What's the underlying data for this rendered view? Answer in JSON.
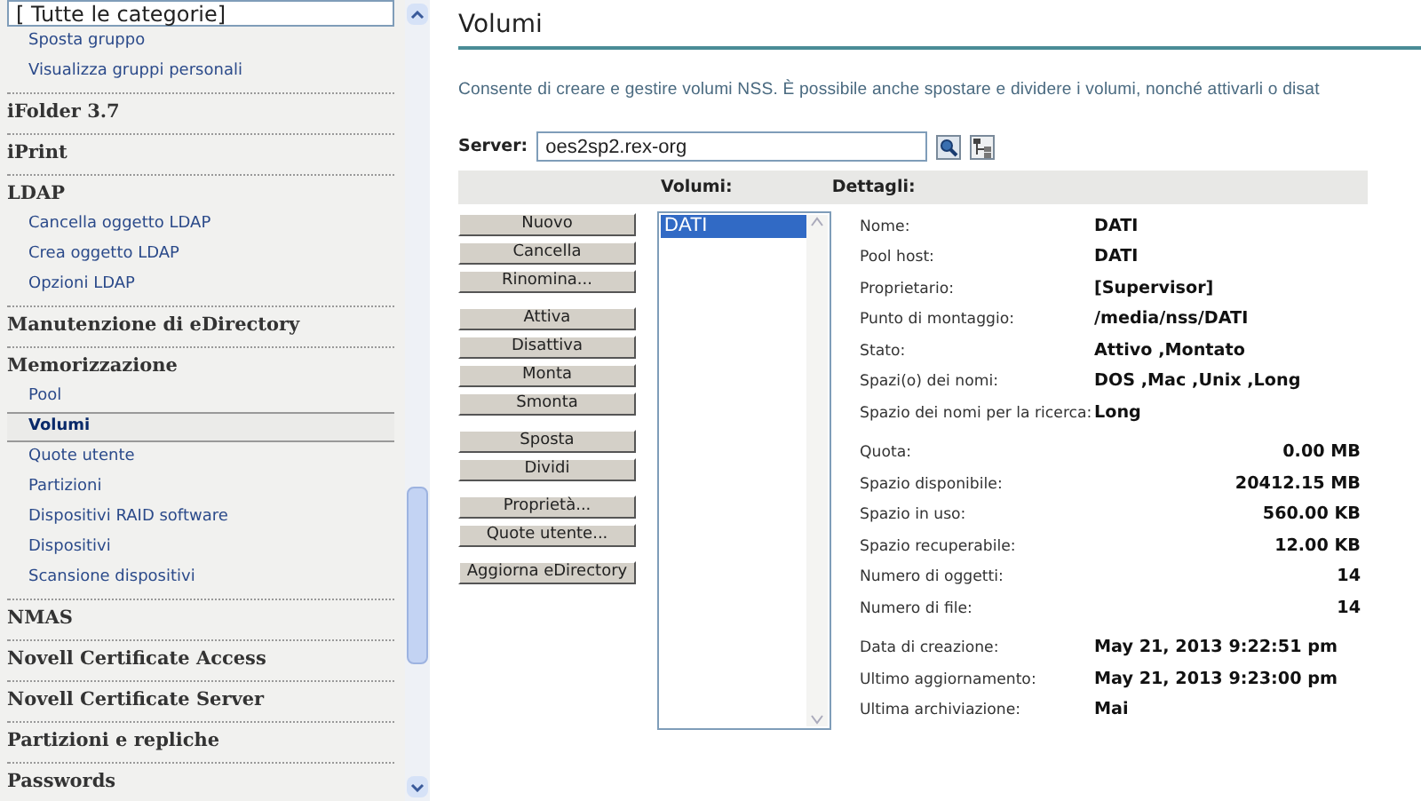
{
  "sidebar": {
    "category_select": {
      "value": "[ Tutte le categorie]"
    },
    "sections": [
      {
        "items": [
          {
            "label": "Sposta gruppo",
            "selected": false
          },
          {
            "label": "Visualizza gruppi personali",
            "selected": false
          }
        ]
      },
      {
        "title": "iFolder 3.7"
      },
      {
        "title": "iPrint"
      },
      {
        "title": "LDAP",
        "items": [
          {
            "label": "Cancella oggetto LDAP",
            "selected": false
          },
          {
            "label": "Crea oggetto LDAP",
            "selected": false
          },
          {
            "label": "Opzioni LDAP",
            "selected": false
          }
        ]
      },
      {
        "title": "Manutenzione di eDirectory"
      },
      {
        "title": "Memorizzazione",
        "items": [
          {
            "label": "Pool",
            "selected": false
          },
          {
            "label": "Volumi",
            "selected": true
          },
          {
            "label": "Quote utente",
            "selected": false
          },
          {
            "label": "Partizioni",
            "selected": false
          },
          {
            "label": "Dispositivi RAID software",
            "selected": false
          },
          {
            "label": "Dispositivi",
            "selected": false
          },
          {
            "label": "Scansione dispositivi",
            "selected": false
          }
        ]
      },
      {
        "title": "NMAS"
      },
      {
        "title": "Novell Certificate Access"
      },
      {
        "title": "Novell Certificate Server"
      },
      {
        "title": "Partizioni e repliche"
      },
      {
        "title": "Passwords"
      }
    ]
  },
  "page": {
    "title": "Volumi",
    "description": "Consente di creare e gestire volumi NSS. È possibile anche spostare e dividere i volumi, nonché attivarli o disat",
    "server": {
      "label": "Server:",
      "value": "oes2sp2.rex-org"
    },
    "columns": {
      "volumes": "Volumi:",
      "details": "Dettagli:"
    },
    "button_groups": [
      [
        "Nuovo",
        "Cancella",
        "Rinomina..."
      ],
      [
        "Attiva",
        "Disattiva",
        "Monta",
        "Smonta"
      ],
      [
        "Sposta",
        "Dividi"
      ],
      [
        "Proprietà...",
        "Quote utente..."
      ],
      [
        "Aggiorna eDirectory"
      ]
    ],
    "volumes": [
      {
        "label": "DATI",
        "selected": true
      }
    ],
    "detail_groups": [
      {
        "kind": "text",
        "rows": [
          {
            "label": "Nome:",
            "value": "DATI"
          },
          {
            "label": "Pool host:",
            "value": "DATI"
          },
          {
            "label": "Proprietario:",
            "value": "[Supervisor]"
          },
          {
            "label": "Punto di montaggio:",
            "value": "/media/nss/DATI"
          },
          {
            "label": "Stato:",
            "value": "Attivo ,Montato"
          },
          {
            "label": "Spazi(o) dei nomi:",
            "value": "DOS ,Mac ,Unix ,Long"
          },
          {
            "label": "Spazio dei nomi per la ricerca:",
            "value": "Long"
          }
        ]
      },
      {
        "kind": "amount",
        "rows": [
          {
            "label": "Quota:",
            "value": "0.00 MB"
          },
          {
            "label": "Spazio disponibile:",
            "value": "20412.15 MB"
          },
          {
            "label": "Spazio in uso:",
            "value": "560.00 KB"
          },
          {
            "label": "Spazio recuperabile:",
            "value": "12.00 KB"
          },
          {
            "label": "Numero di oggetti:",
            "value": "14"
          },
          {
            "label": "Numero di file:",
            "value": "14"
          }
        ]
      },
      {
        "kind": "text",
        "rows": [
          {
            "label": "Data di creazione:",
            "value": "May 21, 2013 9:22:51 pm"
          },
          {
            "label": "Ultimo aggiornamento:",
            "value": "May 21, 2013 9:23:00 pm"
          },
          {
            "label": "Ultima archiviazione:",
            "value": "Mai"
          }
        ]
      }
    ]
  }
}
